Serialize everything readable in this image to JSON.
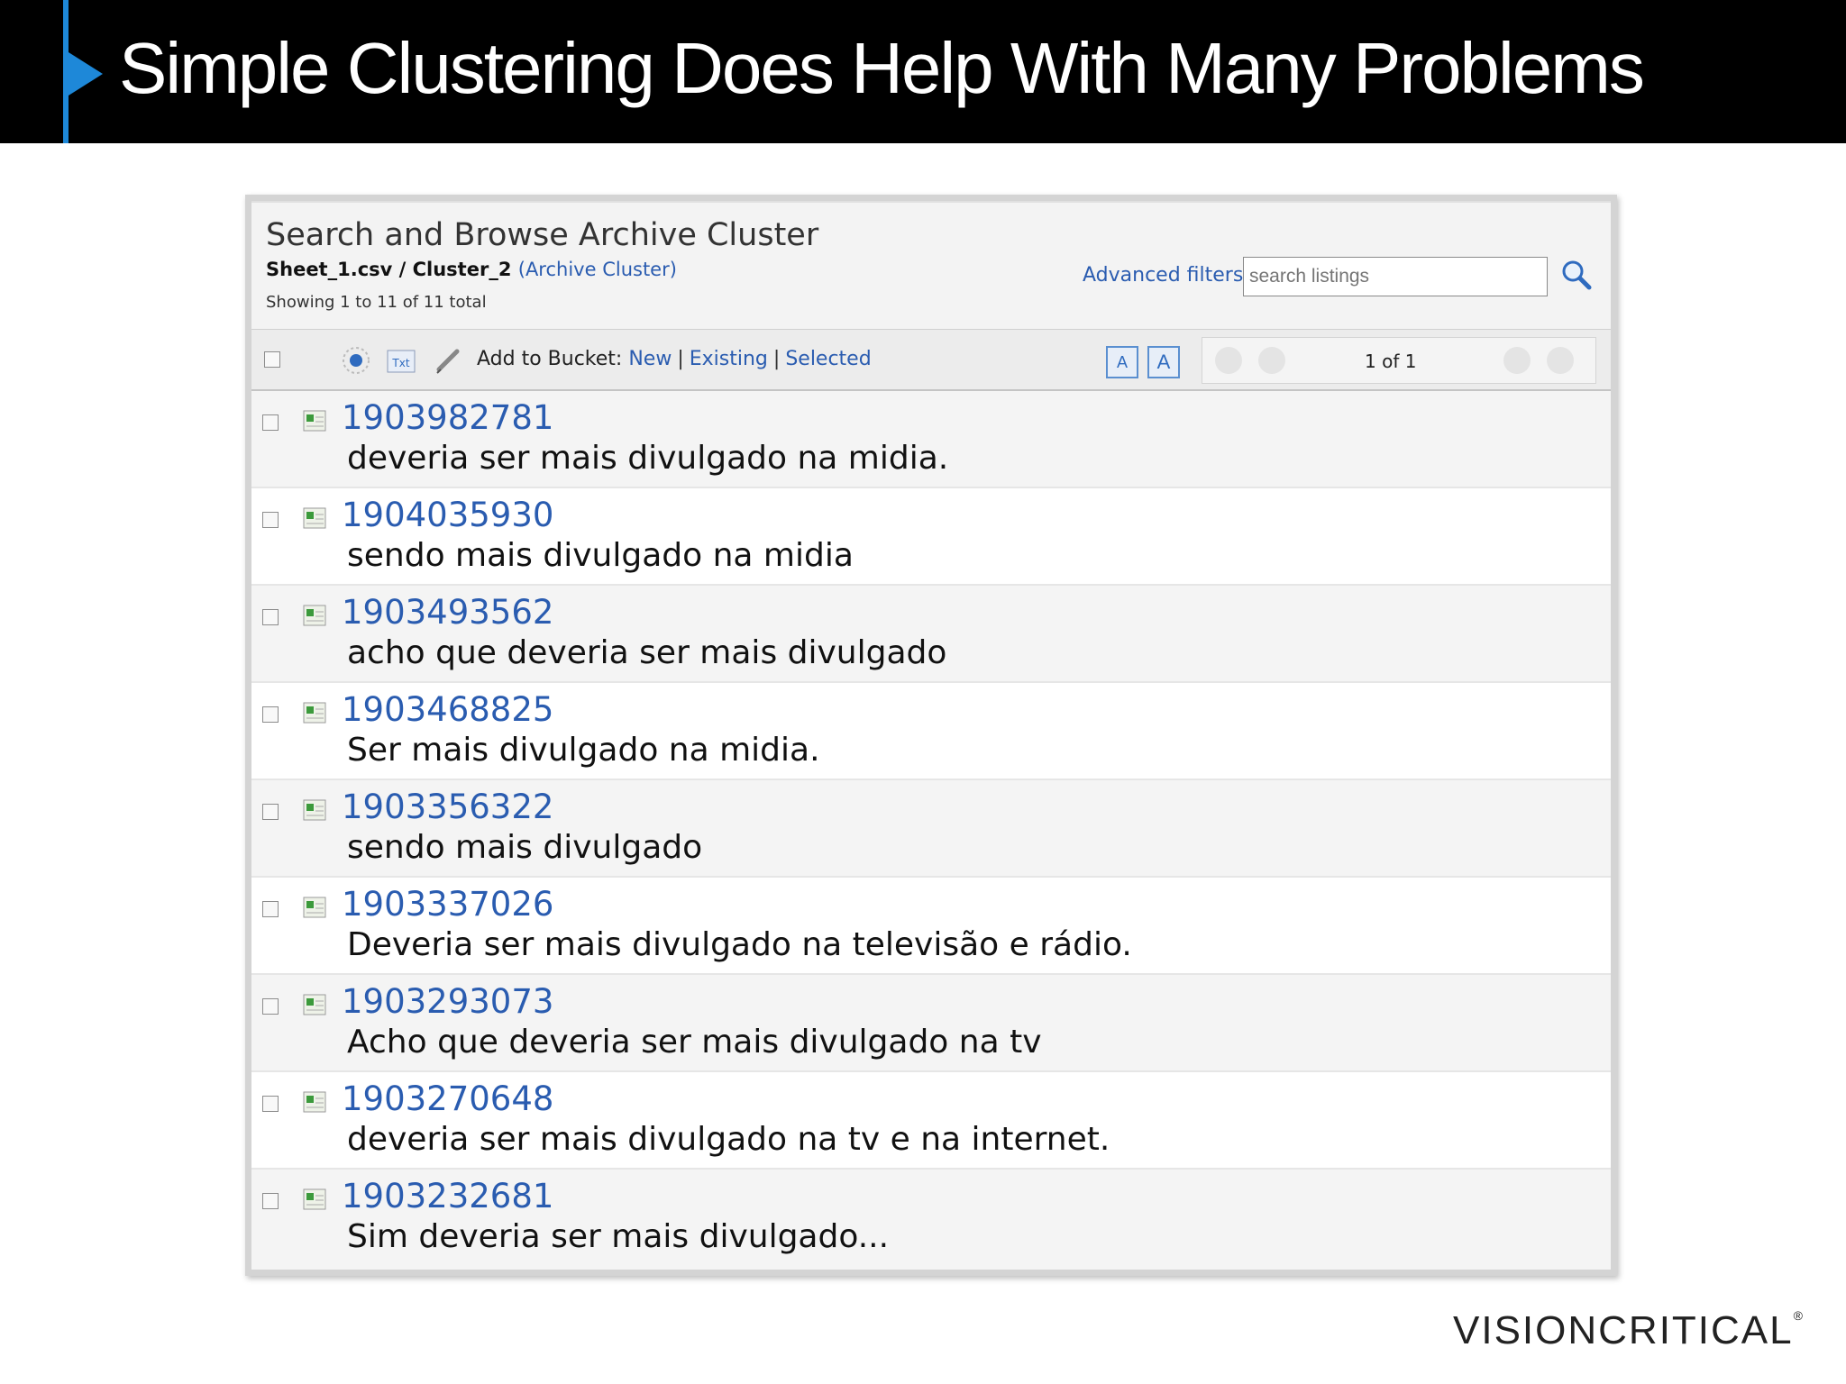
{
  "slide": {
    "title": "Simple Clustering Does Help With Many Problems"
  },
  "panel": {
    "title": "Search and Browse Archive Cluster",
    "file": "Sheet_1.csv / Cluster_2",
    "cluster_type": "(Archive Cluster)",
    "showing": "Showing 1 to 11 of 11 total",
    "advanced_filters": "Advanced filters",
    "search_placeholder": "search listings"
  },
  "toolbar": {
    "add_to_bucket_label": "Add to Bucket:",
    "new": "New",
    "existing": "Existing",
    "selected": "Selected",
    "separator": "|",
    "txt_icon_label": "Txt",
    "font_decrease": "A",
    "font_increase": "A",
    "page_indicator": "1 of 1"
  },
  "rows": [
    {
      "id": "1903982781",
      "text": "deveria ser mais divulgado na midia."
    },
    {
      "id": "1904035930",
      "text": "sendo mais divulgado na midia"
    },
    {
      "id": "1903493562",
      "text": "acho que deveria ser mais divulgado"
    },
    {
      "id": "1903468825",
      "text": "Ser mais divulgado na midia."
    },
    {
      "id": "1903356322",
      "text": "sendo mais divulgado"
    },
    {
      "id": "1903337026",
      "text": "Deveria ser mais divulgado na televisão e rádio."
    },
    {
      "id": "1903293073",
      "text": "Acho que deveria ser mais divulgado na tv"
    },
    {
      "id": "1903270648",
      "text": "deveria ser mais divulgado na tv e na internet."
    },
    {
      "id": "1903232681",
      "text": "Sim deveria ser mais divulgado..."
    }
  ],
  "footer": {
    "logo_text": "VISIONCRITICAL",
    "logo_mark": "®"
  },
  "colors": {
    "header_bg": "#000000",
    "accent_blue": "#1e88d8",
    "link_blue": "#2a5cb0"
  }
}
